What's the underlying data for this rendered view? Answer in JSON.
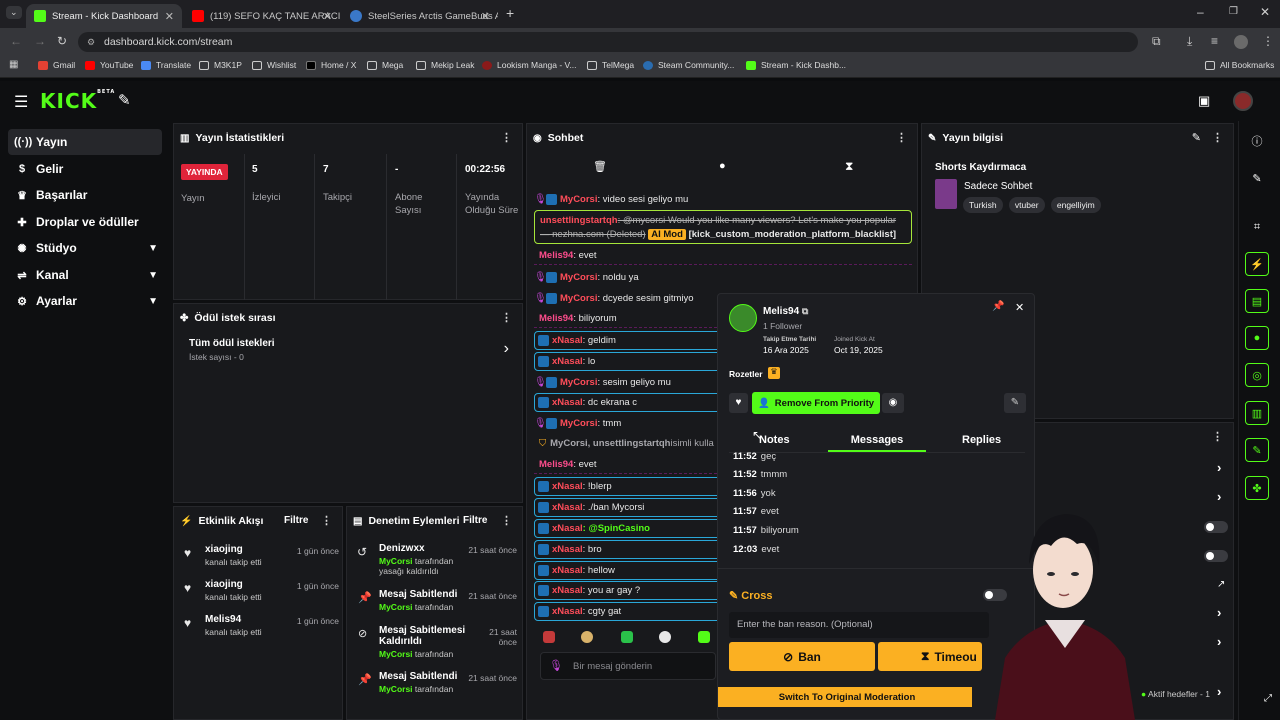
{
  "browser": {
    "tabs": [
      {
        "title": "Stream - Kick Dashboard",
        "color": "#53fc18"
      },
      {
        "title": "(119) SEFO KAÇ TANE ARACI VA",
        "color": "#ff0000"
      },
      {
        "title": "SteelSeries Arctis GameBuds Al",
        "color": "#3a78c8"
      }
    ],
    "url": "dashboard.kick.com/stream",
    "bookmarks": [
      "Gmail",
      "YouTube",
      "Translate",
      "M3K1P",
      "Wishlist",
      "Home / X",
      "Mega",
      "Mekip Leak",
      "Lookism Manga - V...",
      "TelMega",
      "Steam Community...",
      "Stream - Kick Dashb..."
    ],
    "all_bookmarks": "All Bookmarks"
  },
  "app": {
    "logo": "KICK",
    "logo_sup": "BETA",
    "accent": "#53fc18"
  },
  "sidebar": {
    "items": [
      {
        "label": "Yayın",
        "icon": "broadcast-icon"
      },
      {
        "label": "Gelir",
        "icon": "money-icon"
      },
      {
        "label": "Başarılar",
        "icon": "trophy-icon"
      },
      {
        "label": "Droplar ve ödüller",
        "icon": "gift-icon"
      },
      {
        "label": "Stüdyo",
        "icon": "studio-icon"
      },
      {
        "label": "Kanal",
        "icon": "channel-icon"
      },
      {
        "label": "Ayarlar",
        "icon": "gear-icon"
      }
    ]
  },
  "stats": {
    "title": "Yayın İstatistikleri",
    "live_badge": "YAYINDA",
    "live_label": "Yayın",
    "viewers_value": "5",
    "viewers_label": "İzleyici",
    "followers_value": "7",
    "followers_label": "Takipçi",
    "subs_value": "-",
    "subs_label": "Abone Sayısı",
    "uptime_value": "00:22:56",
    "uptime_label": "Yayında Olduğu Süre"
  },
  "rewards": {
    "title": "Ödül istek sırası",
    "all_label": "Tüm ödül istekleri",
    "count_label": "İstek sayısı - 0"
  },
  "activity": {
    "title": "Etkinlik Akışı",
    "filter": "Filtre",
    "items": [
      {
        "user": "xiaojing",
        "action": "kanalı takip etti",
        "time": "1 gün önce"
      },
      {
        "user": "xiaojing",
        "action": "kanalı takip etti",
        "time": "1 gün önce"
      },
      {
        "user": "Melis94",
        "action": "kanalı takip etti",
        "time": "1 gün önce"
      }
    ]
  },
  "modlog": {
    "title": "Denetim Eylemleri",
    "filter": "Filtre",
    "items": [
      {
        "title": "Denizwxx",
        "by": "MyCorsi",
        "desc": "tarafından yasağı kaldırıldı",
        "time": "21 saat önce"
      },
      {
        "title": "Mesaj Sabitlendi",
        "by": "MyCorsi",
        "desc": "tarafından",
        "time": "21 saat önce"
      },
      {
        "title": "Mesaj Sabitlemesi Kaldırıldı",
        "by": "MyCorsi",
        "desc": "tarafından",
        "time": "21 saat önce"
      },
      {
        "title": "Mesaj Sabitlendi",
        "by": "MyCorsi",
        "desc": "tarafından",
        "time": "21 saat önce"
      }
    ]
  },
  "chat": {
    "title": "Sohbet",
    "input_placeholder": "Bir mesaj gönderin",
    "lines": [
      {
        "user": "MyCorsi",
        "msg": ": video sesi geliyo mu",
        "badge": "mic",
        "style": "plain"
      },
      {
        "user": "unsettlingstartqh",
        "msg": ": @mycorsi Would you like many viewers? Let's make you popular — nezhna.com (Deleted)",
        "mod": "AI Mod",
        "tail": "[kick_custom_moderation_platform_blacklist]",
        "style": "mod"
      },
      {
        "user": "Melis94",
        "msg": ": evet",
        "badge": "none",
        "style": "dashed"
      },
      {
        "user": "MyCorsi",
        "msg": ": noldu ya",
        "badge": "mic",
        "style": "plain"
      },
      {
        "user": "MyCorsi",
        "msg": ": dcyede sesim gitmiyo",
        "badge": "mic",
        "style": "plain"
      },
      {
        "user": "Melis94",
        "msg": ": biliyorum",
        "badge": "none",
        "style": "dashed"
      },
      {
        "user": "xNasal",
        "msg": ": geldim",
        "badge": "blue",
        "style": "boxed"
      },
      {
        "user": "xNasal",
        "msg": ": lo",
        "badge": "blue",
        "style": "boxed"
      },
      {
        "user": "MyCorsi",
        "msg": ": sesim geliyo mu",
        "badge": "mic",
        "style": "plain"
      },
      {
        "user": "xNasal",
        "msg": ": dc ekrana c",
        "badge": "blue",
        "style": "boxed"
      },
      {
        "user": "MyCorsi",
        "msg": ": tmm",
        "badge": "mic",
        "style": "plain"
      },
      {
        "user": "MyCorsi, unsettlingstartqh",
        "msg": " isimli kulla",
        "badge": "shield",
        "style": "system"
      },
      {
        "user": "Melis94",
        "msg": ": evet",
        "badge": "none",
        "style": "dashed"
      },
      {
        "user": "xNasal",
        "msg": ": !blerp",
        "badge": "blue",
        "style": "boxed"
      },
      {
        "user": "xNasal",
        "msg": ": ./ban Mycorsi",
        "badge": "blue",
        "style": "boxed"
      },
      {
        "user": "xNasal",
        "msg": ": @SpinCasino",
        "badge": "blue",
        "style": "boxed"
      },
      {
        "user": "xNasal",
        "msg": ": bro",
        "badge": "blue",
        "style": "boxed"
      },
      {
        "user": "xNasal",
        "msg": ": hellow",
        "badge": "blue",
        "style": "boxed"
      },
      {
        "user": "xNasal",
        "msg": ": you ar gay ?",
        "badge": "blue",
        "style": "boxed"
      },
      {
        "user": "xNasal",
        "msg": ": cgty gat",
        "badge": "blue",
        "style": "boxed"
      }
    ]
  },
  "userpopup": {
    "name": "Melis94",
    "followers": "1 Follower",
    "follow_date_label": "Takip Etme Tarihi",
    "follow_date": "16 Ara 2025",
    "joined_label": "Joined Kick At",
    "joined": "Oct 19, 2025",
    "badges_label": "Rozetler",
    "priority_btn": "Remove From Priority",
    "tabs": [
      "Notes",
      "Messages",
      "Replies"
    ],
    "messages": [
      {
        "time": "11:52",
        "text": "geç"
      },
      {
        "time": "11:52",
        "text": "tmmm"
      },
      {
        "time": "11:56",
        "text": "yok"
      },
      {
        "time": "11:57",
        "text": "evet"
      },
      {
        "time": "11:57",
        "text": "biliyorum"
      },
      {
        "time": "12:03",
        "text": "evet"
      }
    ],
    "cross_label": "Cross",
    "ban_placeholder": "Enter the ban reason. (Optional)",
    "ban_btn": "Ban",
    "timeout_btn": "Timeou",
    "switch_btn": "Switch To Original Moderation"
  },
  "streaminfo": {
    "title": "Yayın bilgisi",
    "stream_title": "Shorts Kaydırmaca",
    "category": "Sadece Sohbet",
    "tags": [
      "Turkish",
      "vtuber",
      "engelliyim"
    ],
    "goals": "Aktif hedefler - 1"
  }
}
